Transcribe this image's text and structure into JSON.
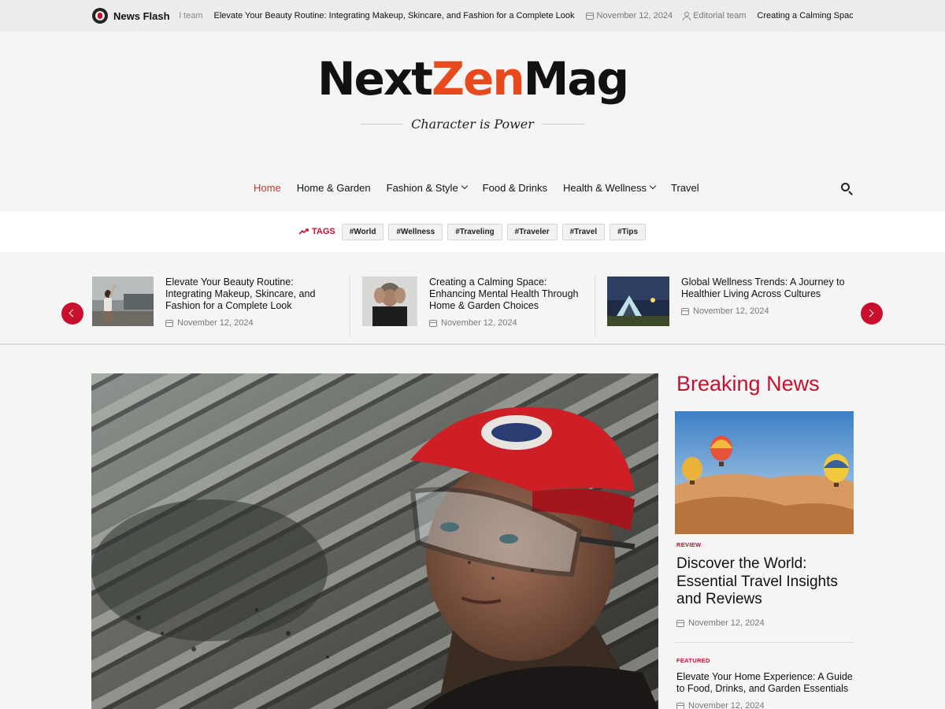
{
  "news_flash": {
    "label": "News Flash",
    "fade_text": "l team",
    "headline": "Elevate Your Beauty Routine: Integrating Makeup, Skincare, and Fashion for a Complete Look",
    "date": "November 12, 2024",
    "author": "Editorial team",
    "next_headline": "Creating a Calming Space: E"
  },
  "logo": {
    "part1": "Next",
    "part2": "Zen",
    "part3": "Mag"
  },
  "tagline": "Character is Power",
  "nav": {
    "items": [
      {
        "label": "Home"
      },
      {
        "label": "Home & Garden"
      },
      {
        "label": "Fashion & Style"
      },
      {
        "label": "Food & Drinks"
      },
      {
        "label": "Health & Wellness"
      },
      {
        "label": "Travel"
      }
    ],
    "search_icon": "search-icon"
  },
  "tags": {
    "label": "TAGS",
    "items": [
      "#World",
      "#Wellness",
      "#Traveling",
      "#Traveler",
      "#Travel",
      "#Tips"
    ]
  },
  "carousel": [
    {
      "title": "Elevate Your Beauty Routine: Integrating Makeup, Skincare, and Fashion for a Complete Look",
      "date": "November 12, 2024"
    },
    {
      "title": "Creating a Calming Space: Enhancing Mental Health Through Home & Garden Choices",
      "date": "November 12, 2024"
    },
    {
      "title": "Global Wellness Trends: A Journey to Healthier Living Across Cultures",
      "date": "November 12, 2024"
    }
  ],
  "breaking": {
    "title": "Breaking News",
    "items": [
      {
        "category": "REVIEW",
        "title": "Discover the World: Essential Travel Insights and Reviews",
        "date": "November 12, 2024"
      },
      {
        "category": "FEATURED",
        "title": "Elevate Your Home Experience: A Guide to Food, Drinks, and Garden Essentials",
        "date": "November 12, 2024"
      }
    ]
  },
  "colors": {
    "accent": "#c8102e",
    "logo_orange": "#e8491d"
  }
}
